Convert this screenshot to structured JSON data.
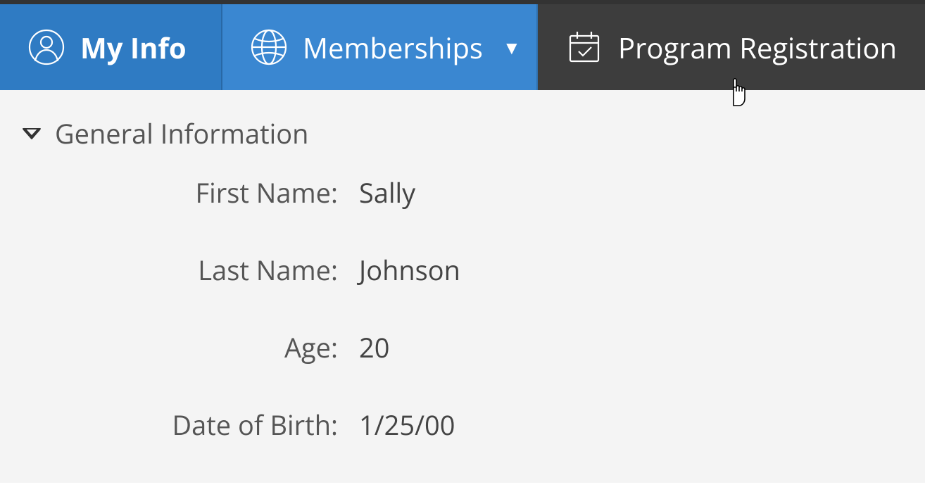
{
  "tabs": {
    "my_info": "My Info",
    "memberships": "Memberships",
    "program_registration": "Program Registration"
  },
  "section": {
    "title": "General Information"
  },
  "fields": {
    "first_name_label": "First Name:",
    "first_name_value": "Sally",
    "last_name_label": "Last Name:",
    "last_name_value": "Johnson",
    "age_label": "Age:",
    "age_value": "20",
    "dob_label": "Date of Birth:",
    "dob_value": "1/25/00"
  }
}
